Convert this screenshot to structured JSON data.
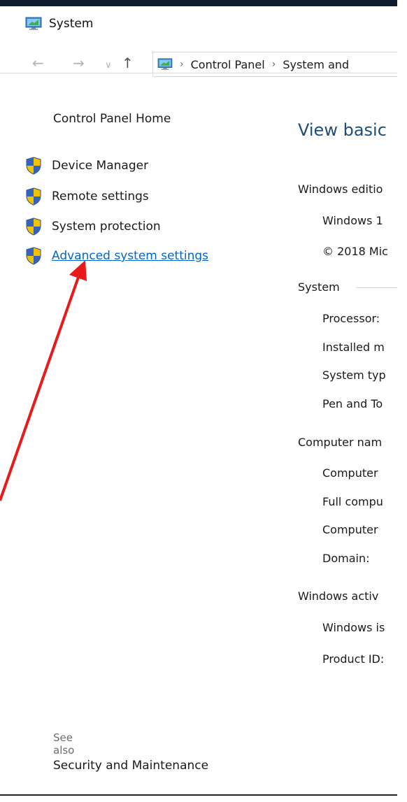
{
  "window": {
    "title": "System",
    "icon": "monitor-icon"
  },
  "address_bar": {
    "back_icon": "arrow-left-icon",
    "forward_icon": "arrow-right-icon",
    "recent_icon": "chevron-down-icon",
    "up_icon": "arrow-up-icon",
    "crumbs": [
      "Control Panel",
      "System and"
    ]
  },
  "sidebar": {
    "home": "Control Panel Home",
    "items": [
      {
        "label": "Device Manager",
        "icon": "uac-shield-icon"
      },
      {
        "label": "Remote settings",
        "icon": "uac-shield-icon"
      },
      {
        "label": "System protection",
        "icon": "uac-shield-icon"
      },
      {
        "label": "Advanced system settings",
        "icon": "uac-shield-icon",
        "link": true
      }
    ],
    "see_also": "See also",
    "security": "Security and Maintenance"
  },
  "main": {
    "heading": "View basic",
    "edition_section": "Windows editio",
    "edition_rows": [
      "Windows 1",
      "© 2018 Mic"
    ],
    "system_section": "System",
    "system_rows": [
      "Processor:",
      "Installed m",
      "System typ",
      "Pen and To"
    ],
    "computer_section": "Computer nam",
    "computer_rows": [
      "Computer",
      "Full compu",
      "Computer",
      "Domain:"
    ],
    "activation_section": "Windows activ",
    "activation_rows": [
      "Windows is",
      "Product ID:"
    ]
  },
  "annotation": {
    "color": "#e81a1a"
  },
  "colors": {
    "link": "#0066cc",
    "heading": "#1e4e79",
    "topbar": "#0f1b2f"
  }
}
